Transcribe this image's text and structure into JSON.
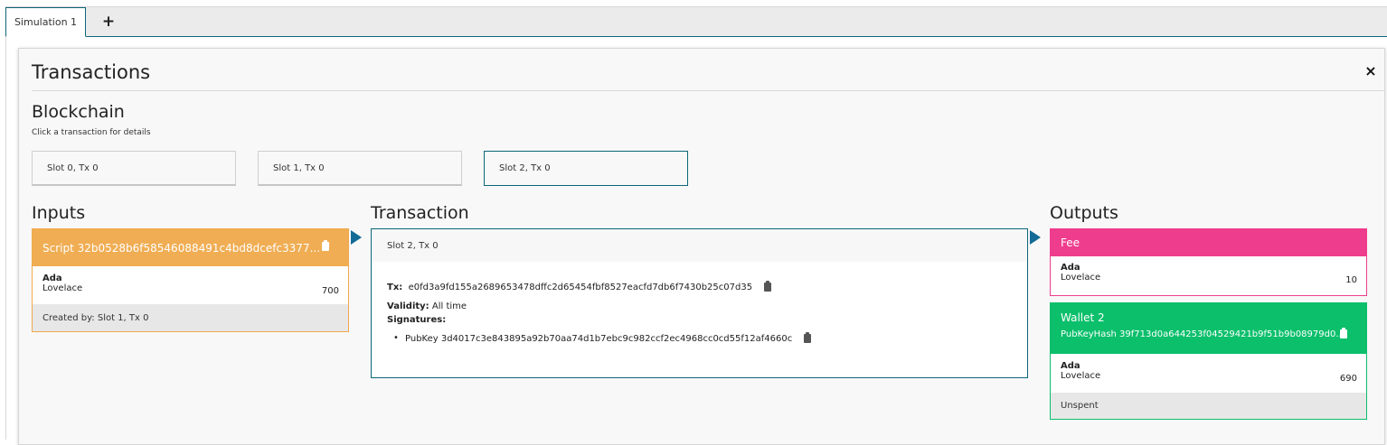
{
  "tabs": {
    "active_label": "Simulation 1",
    "add_label": "+"
  },
  "panel": {
    "title": "Transactions",
    "close_label": "×"
  },
  "blockchain": {
    "heading": "Blockchain",
    "hint": "Click a transaction for details",
    "slots": [
      "Slot 0, Tx 0",
      "Slot 1, Tx 0",
      "Slot 2, Tx 0"
    ],
    "selected_index": 2
  },
  "inputs": {
    "heading": "Inputs",
    "card": {
      "title": "Script 32b0528b6f58546088491c4bd8dcefc3377...",
      "currency": "Ada",
      "token": "Lovelace",
      "amount": "700",
      "footer": "Created by: Slot 1, Tx 0"
    }
  },
  "transaction": {
    "heading": "Transaction",
    "header": "Slot 2, Tx 0",
    "tx_label": "Tx:",
    "tx_hash": "e0fd3a9fd155a2689653478dffc2d65454fbf8527eacfd7db6f7430b25c07d35",
    "validity_label": "Validity:",
    "validity_value": "All time",
    "signatures_label": "Signatures:",
    "signatures": [
      "PubKey 3d4017c3e843895a92b70aa74d1b7ebc9c982ccf2ec4968cc0cd55f12af4660c"
    ]
  },
  "outputs": {
    "heading": "Outputs",
    "fee": {
      "title": "Fee",
      "currency": "Ada",
      "token": "Lovelace",
      "amount": "10"
    },
    "wallet": {
      "title": "Wallet 2",
      "pubkeyhash": "PubKeyHash 39f713d0a644253f04529421b9f51b9b08979d0...",
      "currency": "Ada",
      "token": "Lovelace",
      "amount": "690",
      "footer": "Unspent"
    }
  },
  "colors": {
    "accent": "#0c6678",
    "script_input": "#f0ad53",
    "fee": "#ef3d8d",
    "wallet": "#0bbf6b"
  }
}
